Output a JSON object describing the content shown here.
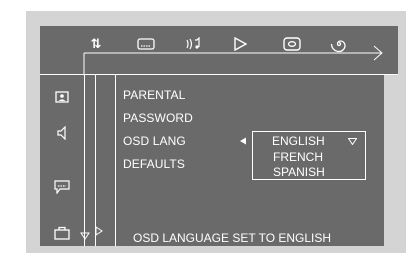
{
  "top_icons": [
    {
      "name": "audio-subtitle-swap-icon",
      "glyph": "⇅"
    },
    {
      "name": "subtitle-icon"
    },
    {
      "name": "audio-language-icon"
    },
    {
      "name": "play-icon"
    },
    {
      "name": "dvd-disc-icon"
    },
    {
      "name": "spiral-icon"
    }
  ],
  "side_icons": [
    {
      "name": "person-icon"
    },
    {
      "name": "speaker-icon"
    },
    {
      "name": "subtitle-box-icon"
    },
    {
      "name": "briefcase-icon"
    }
  ],
  "menu": {
    "items": [
      "PARENTAL",
      "PASSWORD",
      "OSD LANG",
      "DEFAULTS"
    ],
    "selected": "OSD LANG"
  },
  "dropdown": {
    "options": [
      "ENGLISH",
      "FRENCH",
      "SPANISH"
    ],
    "selected": "ENGLISH"
  },
  "status": {
    "message": "OSD LANGUAGE SET TO ENGLISH"
  },
  "colors": {
    "panel": "#6a6a6a",
    "background": "#d4d4d4",
    "text": "#ffffff"
  }
}
